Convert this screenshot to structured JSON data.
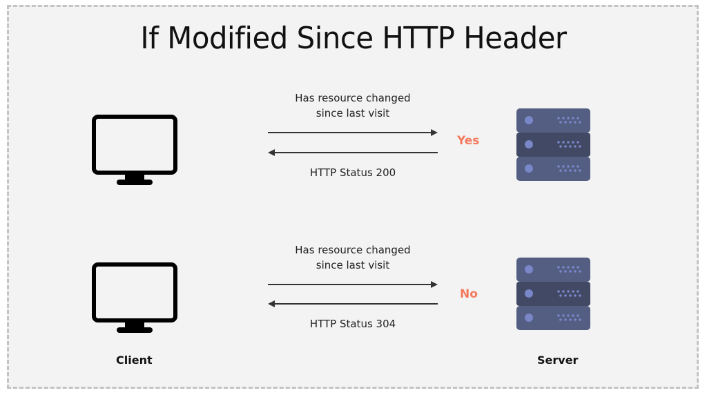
{
  "title": "If Modified Since HTTP Header",
  "colors": {
    "accent": "#f47a5e",
    "server_light": "#545e82",
    "server_dark": "#414964",
    "server_dot": "#7986c8",
    "monitor": "#000000"
  },
  "scenarios": [
    {
      "request_label_line1": "Has resource changed",
      "request_label_line2": "since last visit",
      "answer": "Yes",
      "response_label": "HTTP Status 200"
    },
    {
      "request_label_line1": "Has resource changed",
      "request_label_line2": "since last visit",
      "answer": "No",
      "response_label": "HTTP Status 304"
    }
  ],
  "labels": {
    "client": "Client",
    "server": "Server"
  },
  "icons": {
    "client": "monitor-icon",
    "server": "server-rack-icon"
  }
}
